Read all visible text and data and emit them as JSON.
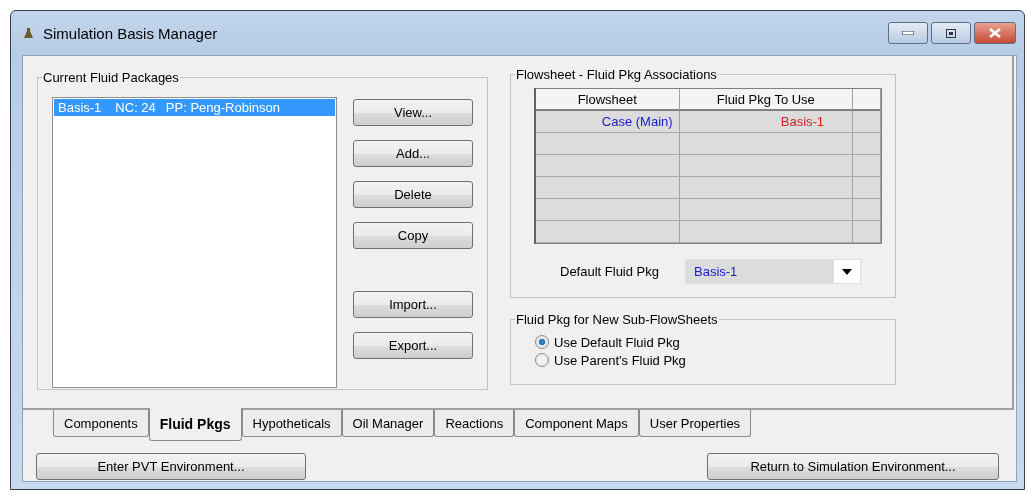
{
  "window": {
    "title": "Simulation Basis Manager"
  },
  "fluid_packages": {
    "label": "Current Fluid Packages",
    "items": [
      {
        "name": "Basis-1",
        "nc": "NC: 24",
        "pp": "PP: Peng-Robinson",
        "selected": true
      }
    ],
    "edit_buttons": [
      "View...",
      "Add...",
      "Delete",
      "Copy"
    ],
    "transfer_buttons": [
      "Import...",
      "Export..."
    ]
  },
  "associations": {
    "label": "Flowsheet - Fluid Pkg Associations",
    "columns": [
      "Flowsheet",
      "Fluid Pkg To Use"
    ],
    "rows": [
      {
        "flowsheet": "Case (Main)",
        "fluid_pkg": "Basis-1"
      }
    ],
    "default_label": "Default Fluid Pkg",
    "default_value": "Basis-1"
  },
  "subflowsheets": {
    "label": "Fluid Pkg for New Sub-FlowSheets",
    "options": [
      {
        "label": "Use Default Fluid Pkg",
        "selected": true
      },
      {
        "label": "Use Parent's Fluid Pkg",
        "selected": false
      }
    ]
  },
  "tabs": [
    {
      "label": "Components",
      "selected": false
    },
    {
      "label": "Fluid Pkgs",
      "selected": true
    },
    {
      "label": "Hypotheticals",
      "selected": false
    },
    {
      "label": "Oil Manager",
      "selected": false
    },
    {
      "label": "Reactions",
      "selected": false
    },
    {
      "label": "Component Maps",
      "selected": false
    },
    {
      "label": "User Properties",
      "selected": false
    }
  ],
  "footer_buttons": [
    "Enter PVT Environment...",
    "Return to Simulation Environment..."
  ]
}
